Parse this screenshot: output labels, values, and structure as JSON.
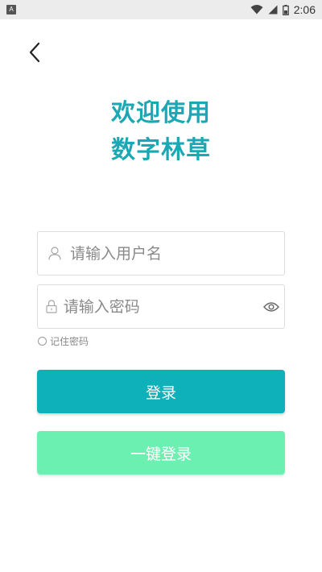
{
  "status_bar": {
    "app_icon_letter": "A",
    "time": "2:06",
    "icons": [
      "wifi-icon",
      "cellular-signal-icon",
      "battery-icon"
    ]
  },
  "nav": {
    "back_icon": "chevron-left-icon"
  },
  "title": {
    "line1": "欢迎使用",
    "line2": "数字林草"
  },
  "username_field": {
    "placeholder": "请输入用户名",
    "value": "",
    "icon": "user-icon"
  },
  "password_field": {
    "placeholder": "请输入密码",
    "value": "",
    "icon": "lock-icon",
    "toggle_icon": "eye-icon"
  },
  "remember_password": {
    "label": "记住密码",
    "checked": false
  },
  "buttons": {
    "login_label": "登录",
    "quick_login_label": "一键登录"
  },
  "colors": {
    "accent": "#1aa8b5",
    "login_button": "#0eb0b9",
    "quick_login_button": "#6cf0b2"
  }
}
